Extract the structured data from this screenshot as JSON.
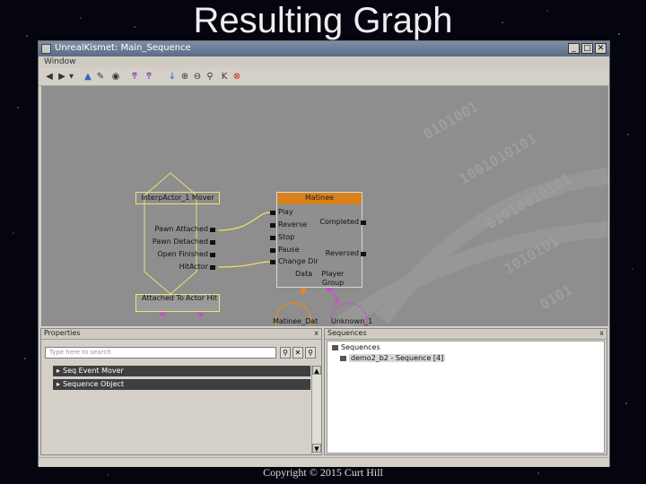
{
  "slide": {
    "title": "Resulting Graph",
    "footer": "Copyright © 2015 Curt Hill"
  },
  "window": {
    "title": "UnrealKismet: Main_Sequence",
    "menu": [
      "Window"
    ],
    "buttons": {
      "minimize": "_",
      "maximize": "□",
      "close": "✕"
    }
  },
  "toolbar": {
    "icons": [
      "back-icon",
      "forward-icon",
      "dropdown-icon",
      "parent-sequence-icon",
      "rename-icon",
      "view-icon",
      "search-icon-a",
      "search-icon-b",
      "pointer-icon",
      "zoom-icon",
      "zoom-out-icon",
      "search-icon",
      "kismet-icon",
      "stop-icon"
    ]
  },
  "graph": {
    "event_node": {
      "title": "InterpActor_1 Mover",
      "outputs": [
        "Pawn Attached",
        "Pawn Detached",
        "Open Finished",
        "HitActor"
      ],
      "vars": [
        "Attached To",
        "Actor Hit"
      ]
    },
    "matinee_node": {
      "title": "Matinee",
      "inputs": [
        "Play",
        "Reverse",
        "Stop",
        "Pause",
        "Change Dir"
      ],
      "outputs": [
        "Completed",
        "Reversed"
      ],
      "vars": [
        "Data",
        "Player Group"
      ],
      "title_color": "#d9821c"
    },
    "variables": [
      {
        "label": "Matinee_Dat",
        "color": "#e08a2a"
      },
      {
        "label": "Unknown_1",
        "color": "#d04ad0"
      }
    ],
    "link_color": "#f0e060"
  },
  "properties": {
    "title": "Properties",
    "close": "x",
    "search_placeholder": "Type here to search",
    "categories": [
      "Seq Event Mover",
      "Sequence Object"
    ]
  },
  "sequences": {
    "title": "Sequences",
    "close": "x",
    "root": "Sequences",
    "child": "demo2_b2 - Sequence [4]"
  }
}
